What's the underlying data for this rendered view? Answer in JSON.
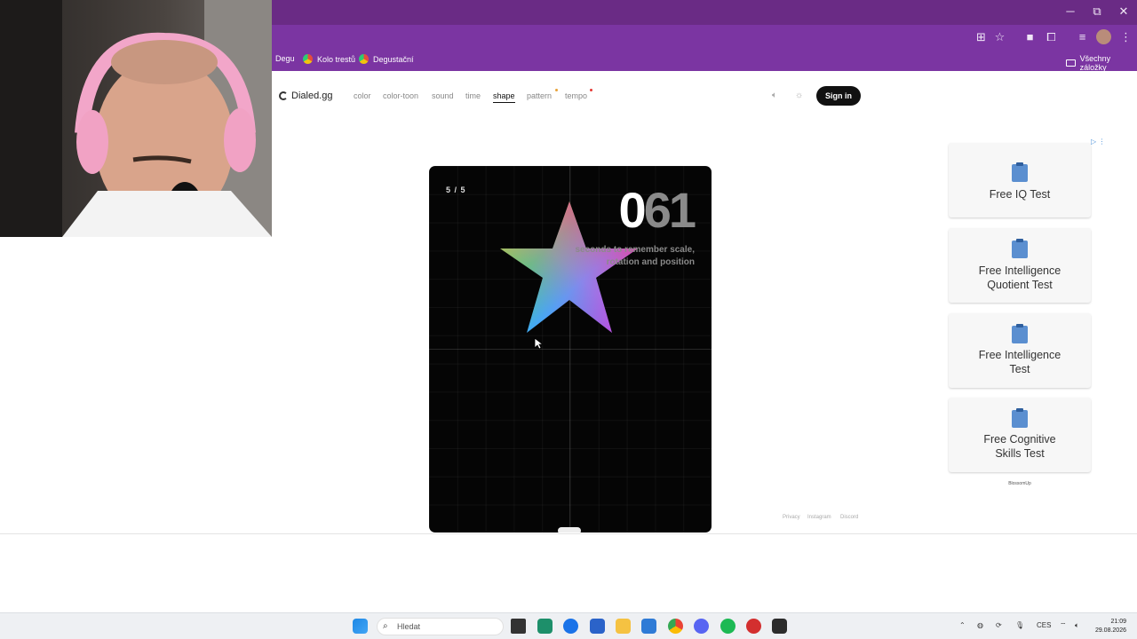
{
  "window": {
    "minimize": "─",
    "restore": "⧉",
    "close": "✕"
  },
  "bookmarks": {
    "items": [
      {
        "label": "Degu"
      },
      {
        "label": "Kolo trestů"
      },
      {
        "label": "Degustační"
      }
    ],
    "all": "Všechny záložky"
  },
  "site": {
    "logo": "Dialed.gg",
    "nav": [
      "color",
      "color-toon",
      "sound",
      "time",
      "shape",
      "pattern",
      "tempo"
    ],
    "active_nav": "shape",
    "signin": "Sign in",
    "footer": [
      "Privacy",
      "Instagram",
      "Discord"
    ]
  },
  "game": {
    "round": "5 / 5",
    "timer_bright": "0",
    "timer_dim": "61",
    "instruction_line1": "seconds to remember scale,",
    "instruction_line2": "rotation and position"
  },
  "ads": {
    "items": [
      {
        "line1": "Free IQ Test",
        "line2": ""
      },
      {
        "line1": "Free Intelligence",
        "line2": "Quotient Test"
      },
      {
        "line1": "Free Intelligence",
        "line2": "Test"
      },
      {
        "line1": "Free Cognitive",
        "line2": "Skills Test"
      }
    ],
    "brand": "BlossomUp"
  },
  "taskbar": {
    "search_placeholder": "Hledat",
    "lang": "CES",
    "time": "21:09",
    "date": "29.08.2026"
  }
}
